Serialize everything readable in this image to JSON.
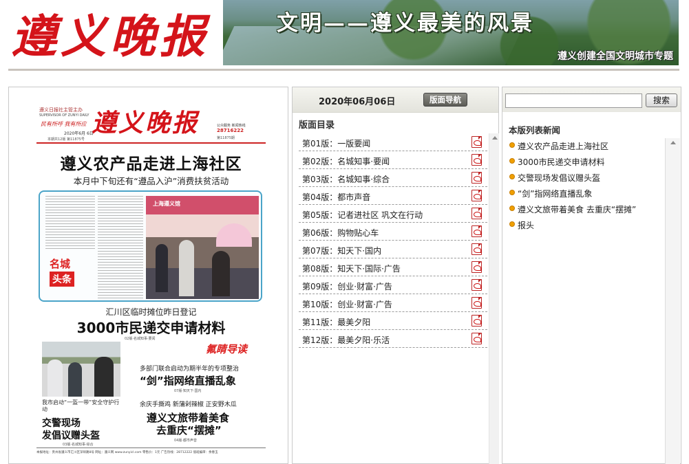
{
  "header": {
    "masthead": "遵义晚报",
    "banner_title": "文明——遵义最美的风景",
    "banner_subtitle": "遵义创建全国文明城市专题"
  },
  "page_thumb": {
    "brand_small": "遵义日报社主管主办",
    "brand_small_en": "SUPERVISOR OF ZUNYI DAILY",
    "slogan": "民有所呼 我有所应",
    "date": "2020年6月 6日",
    "issue": "本期共12版 第11875号",
    "logo": "遵义晚报",
    "hotline_label": "公众服务 新闻热线",
    "hotline": "28716222",
    "meta": "第11875期",
    "headline": "遵义农产品走进上海社区",
    "subhead": "本月中下旬还有“遵品入沪”消费扶贫活动",
    "section_tag_a": "名城",
    "section_tag_b": "头条",
    "stall_sign": "上海遵义馆",
    "h2_small": "汇川区临时摊位昨日登记",
    "h2_big": "3000市民递交申请材料",
    "ref_02": "02版·名城知事·要闻",
    "photo2_caption": "我市启动“一盔一带”安全守护行动",
    "h3_line1": "交警现场",
    "h3_line2": "发倡议赠头盔",
    "ref_03": "03版·名城知事·综合",
    "guide": "氟睛导读",
    "r1_small": "多部门联合启动为期半年的专项整治",
    "r1_big": "“剑”指网络直播乱象",
    "ref_07": "07版·知天下·国内",
    "r2_small": "余庆手撕鸡  新蒲剁辣椒  正安野木瓜",
    "r2_line1": "遵义文旅带着美食",
    "r2_line2": "去重庆“摆摊”",
    "ref_04": "04版·都市声音",
    "footer": "本报地址：贵州省遵义市汇川区深圳路8号   网址：遵义网 www.zunyicl.com   零售价：1元   广告热线：28712222   值班编审：余春玉"
  },
  "middle": {
    "issue_date": "2020年06月06日",
    "nav_button": "版面导航",
    "toc_title": "版面目录",
    "pages": [
      {
        "label": "第01版：一版要闻"
      },
      {
        "label": "第02版：名城知事·要闻"
      },
      {
        "label": "第03版：名城知事·综合"
      },
      {
        "label": "第04版：都市声音"
      },
      {
        "label": "第05版：记者进社区 巩文在行动"
      },
      {
        "label": "第06版：购物贴心车"
      },
      {
        "label": "第07版：知天下·国内"
      },
      {
        "label": "第08版：知天下·国际·广告"
      },
      {
        "label": "第09版：创业·财富·广告"
      },
      {
        "label": "第10版：创业·财富·广告"
      },
      {
        "label": "第11版：最美夕阳"
      },
      {
        "label": "第12版：最美夕阳·乐活"
      }
    ],
    "pdf_icon": "pdf-icon"
  },
  "right": {
    "search_value": "",
    "search_button": "搜索",
    "news_title": "本版列表新闻",
    "news": [
      {
        "text": "遵义农产品走进上海社区"
      },
      {
        "text": "3000市民递交申请材料"
      },
      {
        "text": "交警现场发倡议赠头盔"
      },
      {
        "text": "“剑”指网络直播乱象"
      },
      {
        "text": "遵义文旅带着美食 去重庆“摆摊”"
      },
      {
        "text": "报头"
      }
    ]
  },
  "colors": {
    "masthead_red": "#d4141a",
    "bullet_orange": "#f0a000",
    "panel_border": "#c9c9c9"
  }
}
